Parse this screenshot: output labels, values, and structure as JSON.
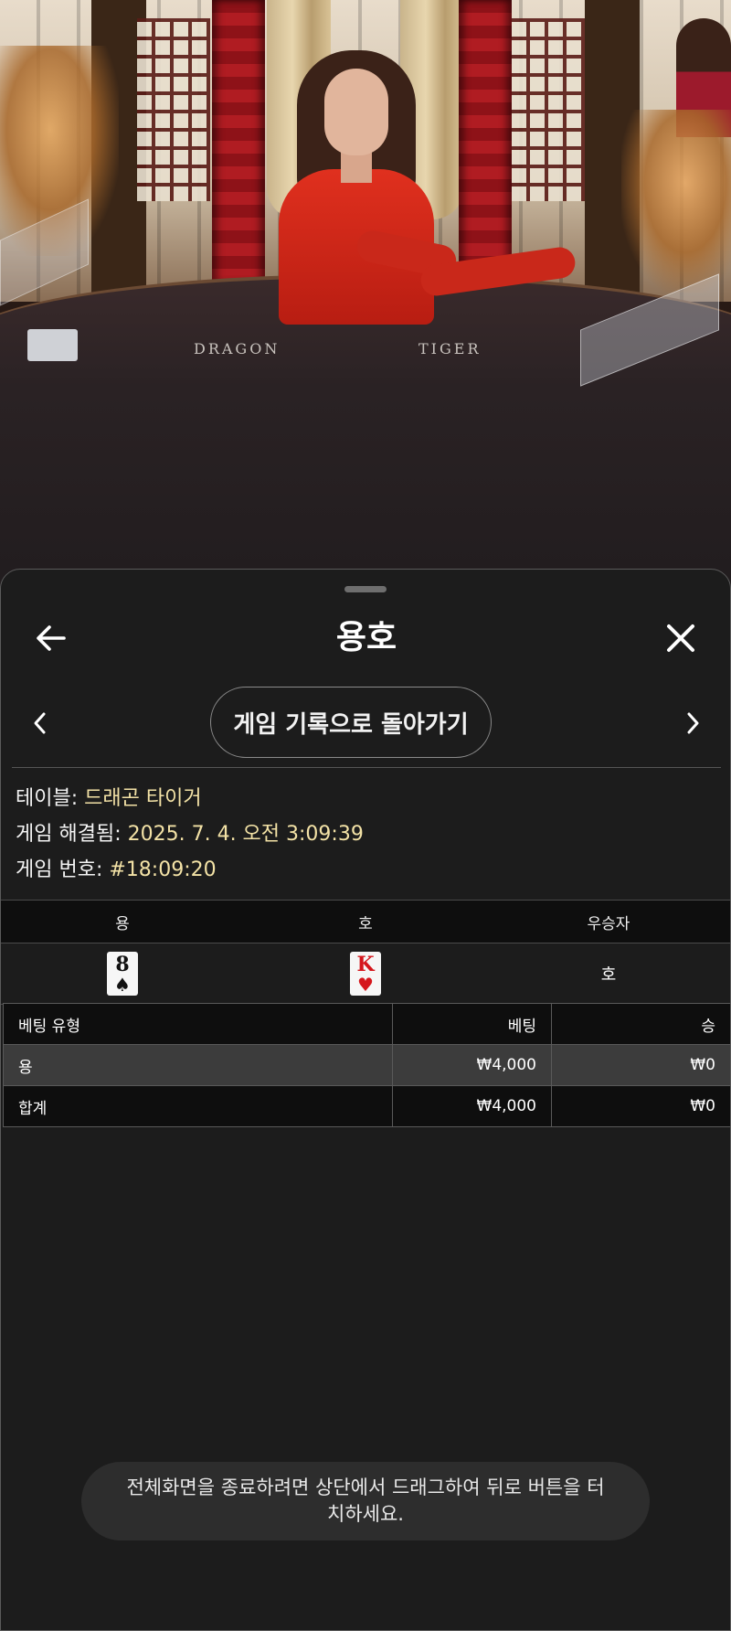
{
  "video": {
    "table_word_left": "DRAGON",
    "table_word_right": "TIGER"
  },
  "sheet": {
    "title": "용호",
    "back_icon": "arrow-left-icon",
    "close_icon": "close-icon",
    "nav": {
      "prev_icon": "chevron-left-icon",
      "next_icon": "chevron-right-icon",
      "back_to_history_label": "게임 기록으로 돌아가기"
    },
    "info": {
      "table_label": "테이블:",
      "table_value": "드래곤 타이거",
      "resolved_label": "게임 해결됨:",
      "resolved_value": "2025. 7. 4. 오전 3:09:39",
      "game_no_label": "게임 번호:",
      "game_no_value": "#18:09:20"
    },
    "result": {
      "headers": [
        "용",
        "호",
        "우승자"
      ],
      "dragon_card": {
        "rank": "8",
        "suit": "♠",
        "color": "black"
      },
      "tiger_card": {
        "rank": "K",
        "suit": "♥",
        "color": "red"
      },
      "winner": "호"
    },
    "bets": {
      "headers": [
        "베팅 유형",
        "베팅",
        "승"
      ],
      "rows": [
        {
          "type": "용",
          "bet": "₩4,000",
          "win": "₩0"
        }
      ],
      "total": {
        "type": "합계",
        "bet": "₩4,000",
        "win": "₩0"
      }
    }
  },
  "toast": {
    "message": "전체화면을 종료하려면 상단에서 드래그하여 뒤로 버튼을 터치하세요."
  },
  "colors": {
    "sheet_bg": "#1c1c1c",
    "header_row_bg": "#0e0e0e",
    "highlight_row_bg": "#3c3c3c",
    "info_value": "#f3e2a6",
    "card_red": "#d5161c"
  }
}
